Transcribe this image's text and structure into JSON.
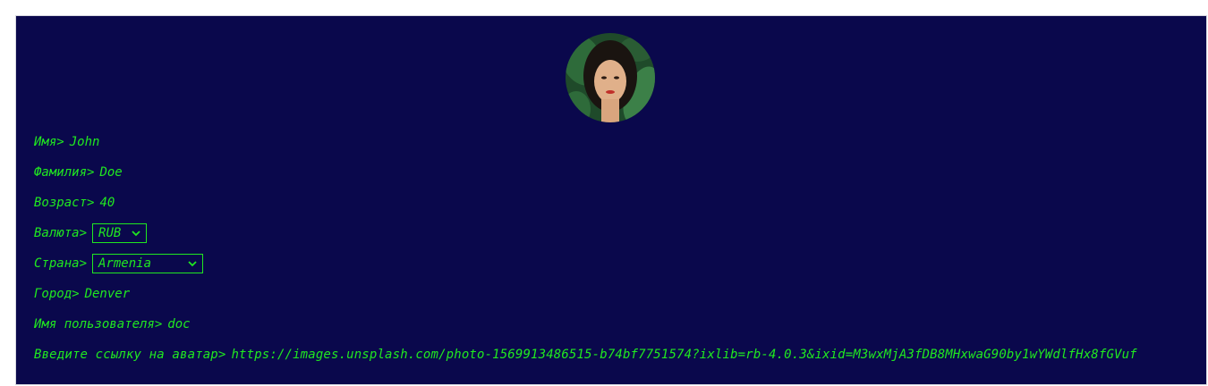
{
  "profile": {
    "first_name": {
      "label": "Имя>",
      "value": "John"
    },
    "last_name": {
      "label": "Фамилия>",
      "value": "Doe"
    },
    "age": {
      "label": "Возраст>",
      "value": "40"
    },
    "currency": {
      "label": "Валюта>",
      "selected": "RUB"
    },
    "country": {
      "label": "Страна>",
      "selected": "Armenia"
    },
    "city": {
      "label": "Город>",
      "value": "Denver"
    },
    "username": {
      "label": "Имя пользователя>",
      "value": "doc"
    },
    "avatar_url": {
      "label": "Введите ссылку на аватар>",
      "value": "https://images.unsplash.com/photo-1569913486515-b74bf7751574?ixlib=rb-4.0.3&ixid=M3wxMjA3fDB8MHxwaG90by1wYWdlfHx8fGVuf"
    }
  },
  "colors": {
    "background": "#0a084c",
    "text": "#20e820"
  },
  "icons": {
    "avatar": "avatar-photo",
    "select": "chevron-down-icon"
  }
}
